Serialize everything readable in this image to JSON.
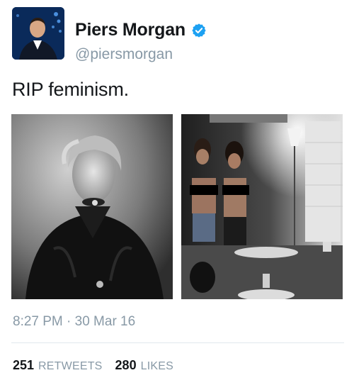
{
  "tweet": {
    "display_name": "Piers Morgan",
    "handle": "@piersmorgan",
    "text": "RIP feminism.",
    "timestamp": "8:27 PM · 30 Mar 16",
    "retweets": {
      "count": "251",
      "label": "RETWEETS"
    },
    "likes": {
      "count": "280",
      "label": "LIKES"
    },
    "verified_color": "#1da1f2"
  },
  "icons": {
    "verified": "verified-badge-icon",
    "avatar": "profile-photo"
  }
}
